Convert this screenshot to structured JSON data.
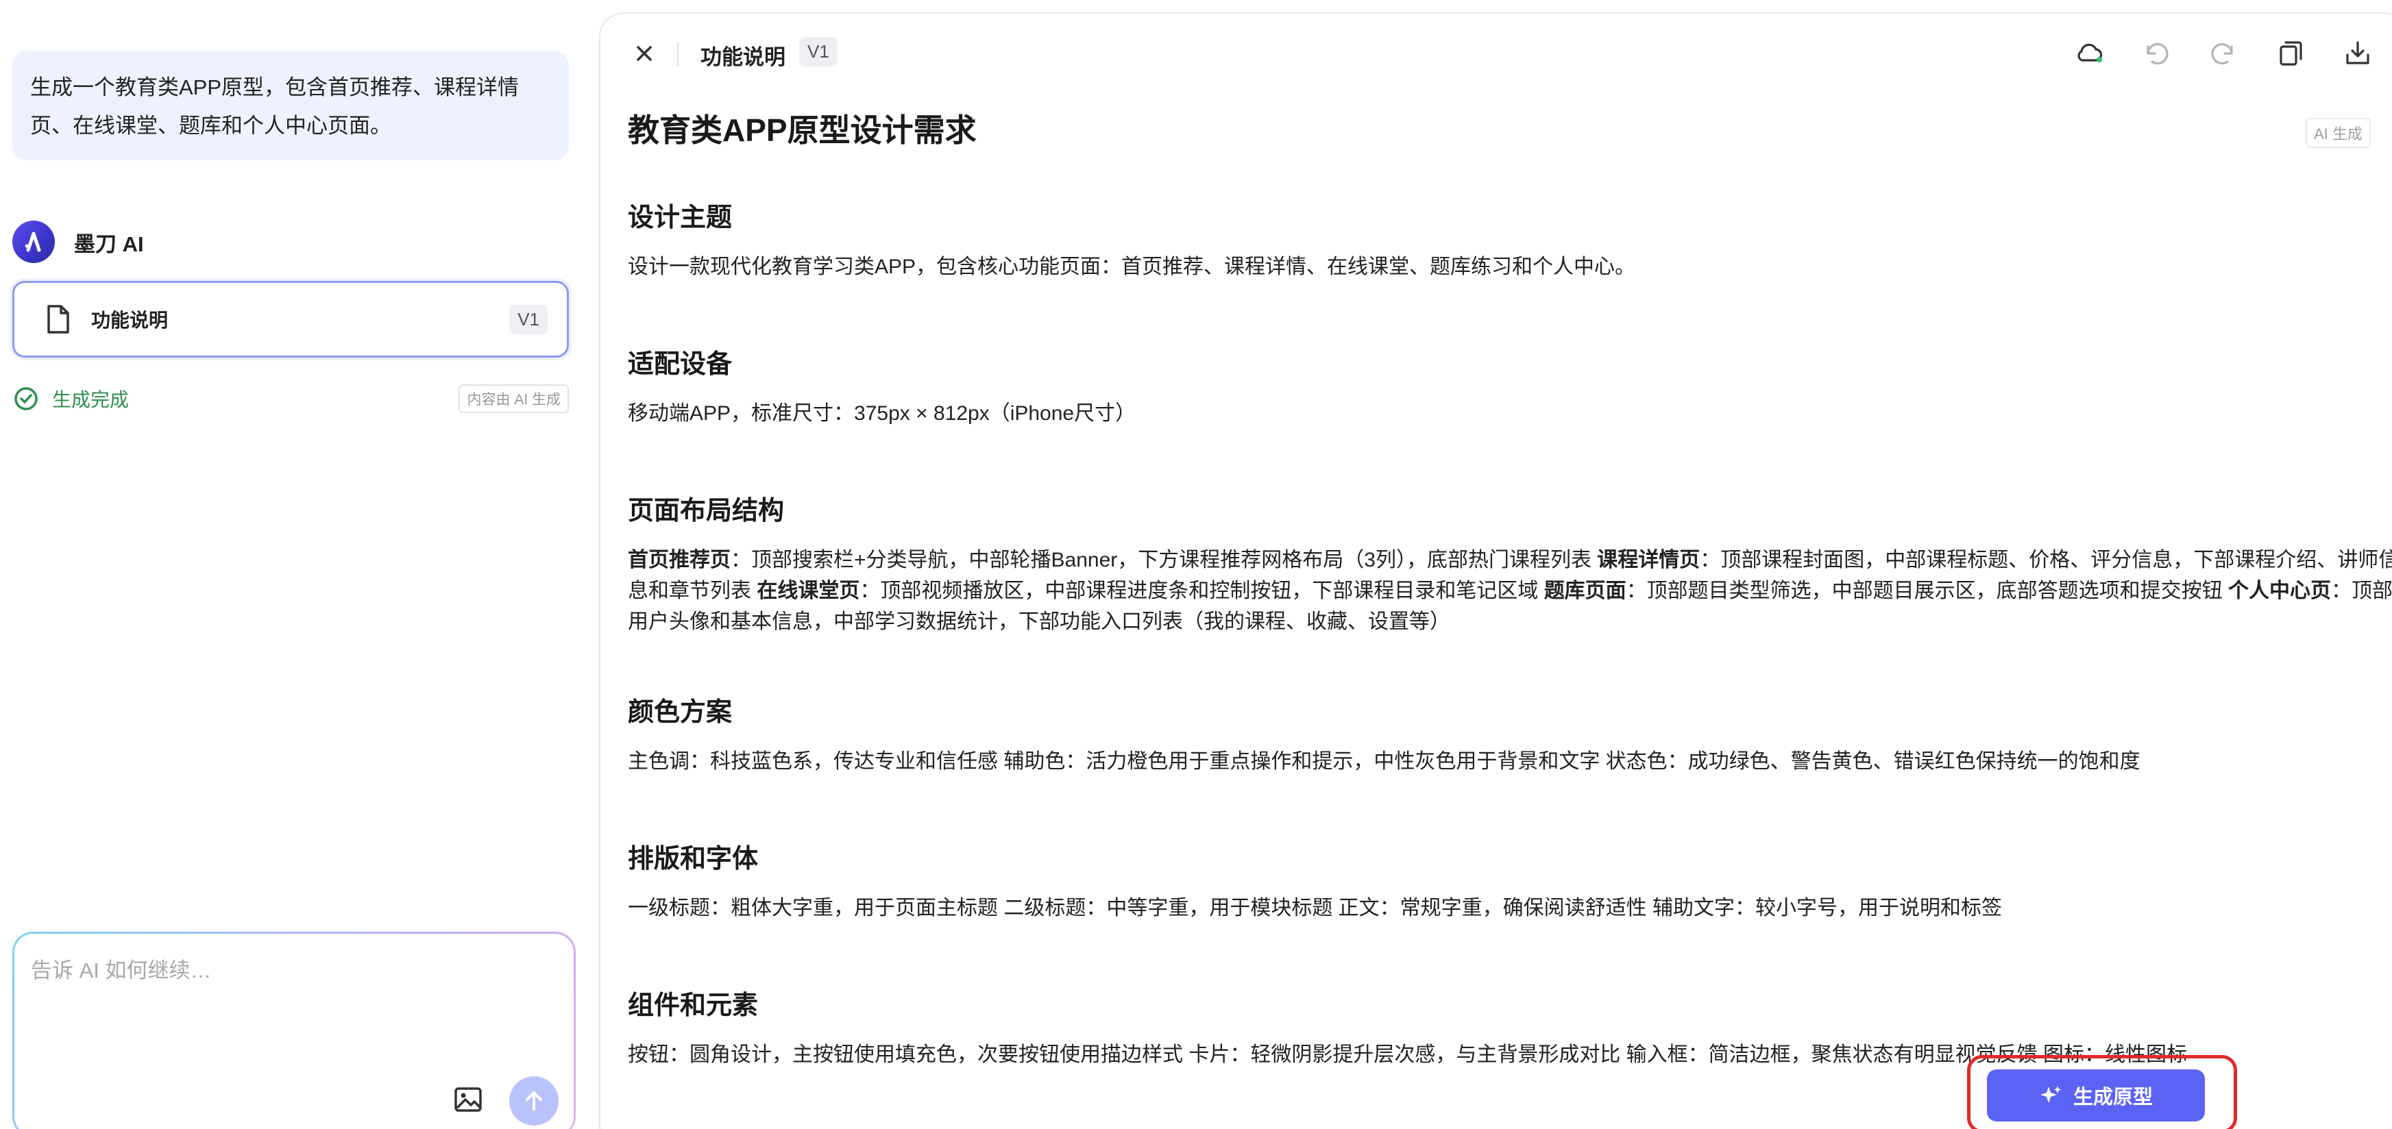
{
  "chat": {
    "user_message": "生成一个教育类APP原型，包含首页推荐、课程详情页、在线课堂、题库和个人中心页面。",
    "assistant_name": "墨刀 AI",
    "doc_card": {
      "title": "功能说明",
      "version": "V1"
    },
    "status_text": "生成完成",
    "ai_tag": "内容由 AI 生成",
    "composer_placeholder": "告诉 AI 如何继续…"
  },
  "document": {
    "topbar_title": "功能说明",
    "topbar_version": "V1",
    "ai_tag": "AI 生成",
    "title": "教育类APP原型设计需求",
    "sections": [
      {
        "heading": "设计主题",
        "body": "设计一款现代化教育学习类APP，包含核心功能页面：首页推荐、课程详情、在线课堂、题库练习和个人中心。"
      },
      {
        "heading": "适配设备",
        "body": "移动端APP，标准尺寸：375px × 812px（iPhone尺寸）"
      },
      {
        "heading": "页面布局结构",
        "runs": [
          {
            "b": "首页推荐页",
            "t": "：顶部搜索栏+分类导航，中部轮播Banner，下方课程推荐网格布局（3列），底部热门课程列表 "
          },
          {
            "b": "课程详情页",
            "t": "：顶部课程封面图，中部课程标题、价格、评分信息，下部课程介绍、讲师信息和章节列表 "
          },
          {
            "b": "在线课堂页",
            "t": "：顶部视频播放区，中部课程进度条和控制按钮，下部课程目录和笔记区域 "
          },
          {
            "b": "题库页面",
            "t": "：顶部题目类型筛选，中部题目展示区，底部答题选项和提交按钮 "
          },
          {
            "b": "个人中心页",
            "t": "：顶部用户头像和基本信息，中部学习数据统计，下部功能入口列表（我的课程、收藏、设置等）"
          }
        ]
      },
      {
        "heading": "颜色方案",
        "body": "主色调：科技蓝色系，传达专业和信任感 辅助色：活力橙色用于重点操作和提示，中性灰色用于背景和文字 状态色：成功绿色、警告黄色、错误红色保持统一的饱和度"
      },
      {
        "heading": "排版和字体",
        "body": "一级标题：粗体大字重，用于页面主标题 二级标题：中等字重，用于模块标题 正文：常规字重，确保阅读舒适性 辅助文字：较小字号，用于说明和标签"
      },
      {
        "heading": "组件和元素",
        "body": "按钮：圆角设计，主按钮使用填充色，次要按钮使用描边样式 卡片：轻微阴影提升层次感，与主背景形成对比 输入框：简洁边框，聚焦状态有明显视觉反馈 图标：线性图标"
      }
    ],
    "generate_button": "生成原型"
  },
  "colors": {
    "accent": "#5b63f5",
    "status_success": "#2f8f4e",
    "highlight_box": "#e02a2a"
  },
  "icons": {
    "close": "close-icon",
    "cloud": "cloud-sync-icon",
    "undo": "undo-icon",
    "redo": "redo-icon",
    "copy": "copy-icon",
    "download": "download-icon",
    "image": "image-upload-icon",
    "send": "send-arrow-icon",
    "sparkle": "sparkle-icon",
    "file": "file-icon",
    "check": "check-circle-icon"
  }
}
